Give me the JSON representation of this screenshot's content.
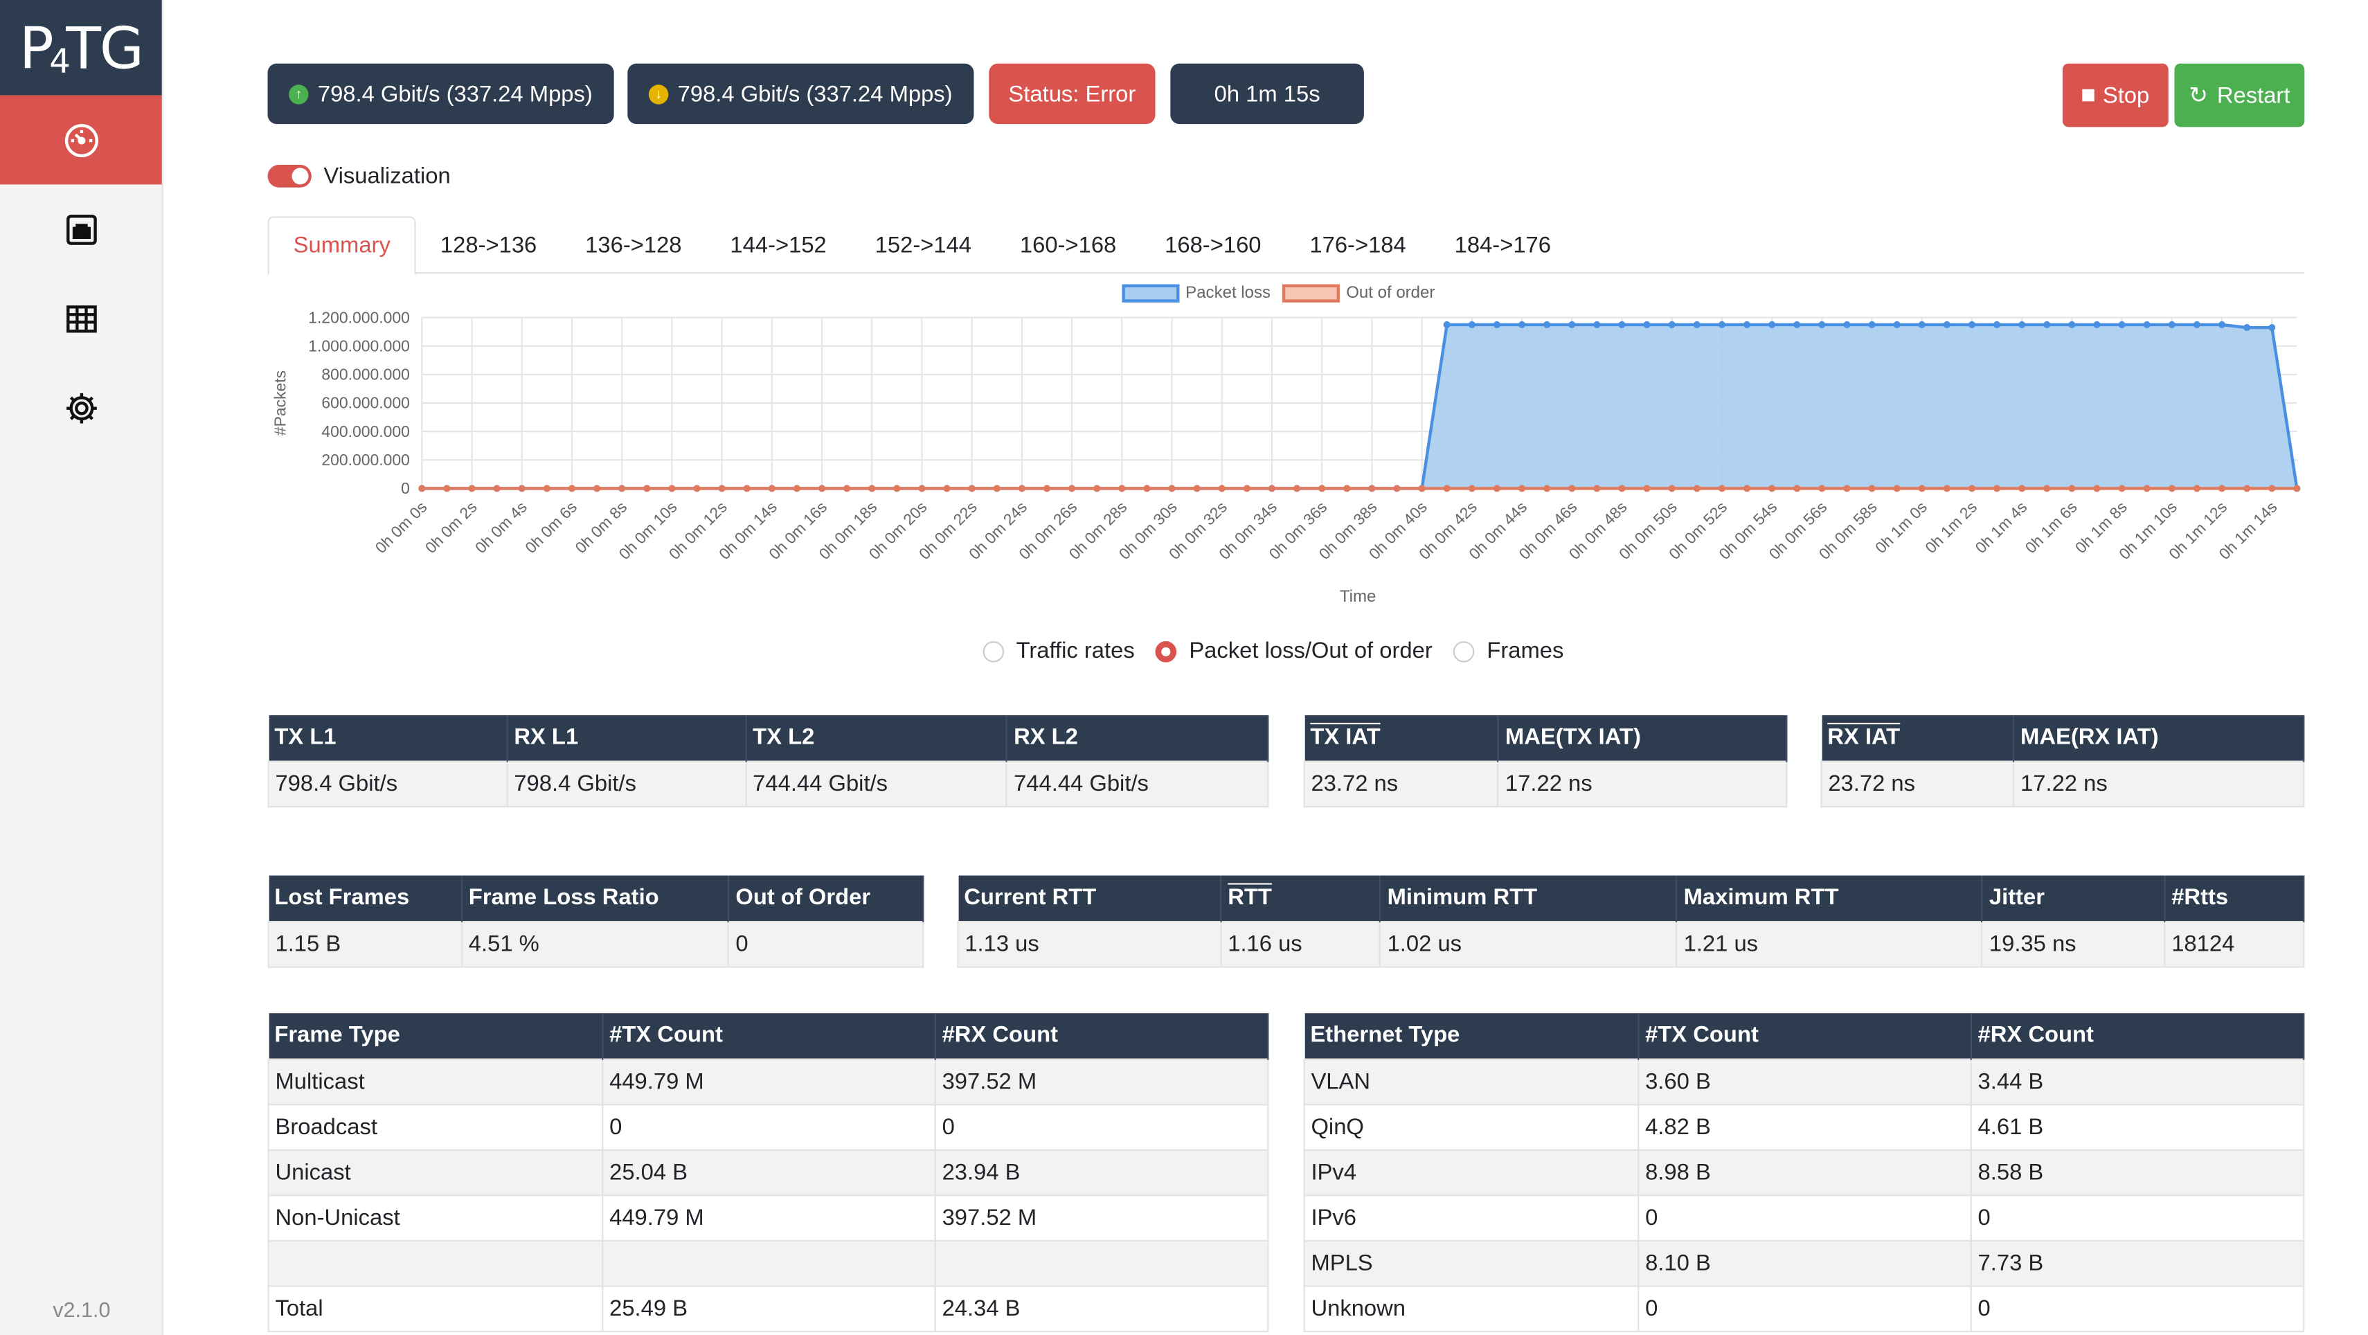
{
  "app": {
    "logo": "P4TG",
    "version": "v2.1.0"
  },
  "sidebar": {
    "items": [
      {
        "icon": "speedometer-icon",
        "active": true
      },
      {
        "icon": "ethernet-port-icon",
        "active": false
      },
      {
        "icon": "table-grid-icon",
        "active": false
      },
      {
        "icon": "gear-icon",
        "active": false
      }
    ]
  },
  "topbar": {
    "tx_rate": "798.4 Gbit/s (337.24 Mpps)",
    "rx_rate": "798.4 Gbit/s (337.24 Mpps)",
    "status": "Status: Error",
    "elapsed": "0h 1m 15s",
    "stop_label": "Stop",
    "restart_label": "Restart",
    "colors": {
      "dark": "#2e3c50",
      "red": "#d9534f",
      "green": "#4caf50"
    }
  },
  "visualization": {
    "label": "Visualization",
    "enabled": true
  },
  "tabs": [
    "Summary",
    "128->136",
    "136->128",
    "144->152",
    "152->144",
    "160->168",
    "168->160",
    "176->184",
    "184->176"
  ],
  "chart_data": {
    "type": "line",
    "xlabel": "Time",
    "ylabel": "#Packets",
    "ylim": [
      0,
      1200000000
    ],
    "y_ticks": [
      "0",
      "200.000.000",
      "400.000.000",
      "600.000.000",
      "800.000.000",
      "1.000.000.000",
      "1.200.000.000"
    ],
    "x_tick_labels": [
      "0h 0m 0s",
      "0h 0m 2s",
      "0h 0m 4s",
      "0h 0m 6s",
      "0h 0m 8s",
      "0h 0m 10s",
      "0h 0m 12s",
      "0h 0m 14s",
      "0h 0m 16s",
      "0h 0m 18s",
      "0h 0m 20s",
      "0h 0m 22s",
      "0h 0m 24s",
      "0h 0m 26s",
      "0h 0m 28s",
      "0h 0m 30s",
      "0h 0m 32s",
      "0h 0m 34s",
      "0h 0m 36s",
      "0h 0m 38s",
      "0h 0m 40s",
      "0h 0m 42s",
      "0h 0m 44s",
      "0h 0m 46s",
      "0h 0m 48s",
      "0h 0m 50s",
      "0h 0m 52s",
      "0h 0m 54s",
      "0h 0m 56s",
      "0h 0m 58s",
      "0h 1m 0s",
      "0h 1m 2s",
      "0h 1m 4s",
      "0h 1m 6s",
      "0h 1m 8s",
      "0h 1m 10s",
      "0h 1m 12s",
      "0h 1m 14s"
    ],
    "grid": true,
    "legend_position": "top",
    "series": [
      {
        "name": "Packet loss",
        "color": "#4a90e2",
        "fill": "#a9ccf0",
        "values": [
          0,
          0,
          0,
          0,
          0,
          0,
          0,
          0,
          0,
          0,
          0,
          0,
          0,
          0,
          0,
          0,
          0,
          0,
          0,
          0,
          0,
          0,
          0,
          0,
          0,
          0,
          0,
          0,
          0,
          0,
          0,
          0,
          0,
          0,
          0,
          0,
          0,
          0,
          0,
          0,
          0,
          1150000000,
          1150000000,
          1150000000,
          1150000000,
          1150000000,
          1150000000,
          1150000000,
          1150000000,
          1150000000,
          1150000000,
          1150000000,
          1150000000,
          1150000000,
          1150000000,
          1150000000,
          1150000000,
          1150000000,
          1150000000,
          1150000000,
          1150000000,
          1150000000,
          1150000000,
          1150000000,
          1150000000,
          1150000000,
          1150000000,
          1150000000,
          1150000000,
          1150000000,
          1150000000,
          1150000000,
          1150000000,
          1130000000,
          1130000000,
          0
        ]
      },
      {
        "name": "Out of order",
        "color": "#e07a5f",
        "fill": "#f6c6b3",
        "values": [
          0,
          0,
          0,
          0,
          0,
          0,
          0,
          0,
          0,
          0,
          0,
          0,
          0,
          0,
          0,
          0,
          0,
          0,
          0,
          0,
          0,
          0,
          0,
          0,
          0,
          0,
          0,
          0,
          0,
          0,
          0,
          0,
          0,
          0,
          0,
          0,
          0,
          0,
          0,
          0,
          0,
          0,
          0,
          0,
          0,
          0,
          0,
          0,
          0,
          0,
          0,
          0,
          0,
          0,
          0,
          0,
          0,
          0,
          0,
          0,
          0,
          0,
          0,
          0,
          0,
          0,
          0,
          0,
          0,
          0,
          0,
          0,
          0,
          0,
          0,
          0
        ]
      }
    ]
  },
  "radio": {
    "options": [
      "Traffic rates",
      "Packet loss/Out of order",
      "Frames"
    ],
    "selected": 1
  },
  "table_rates": {
    "headers": [
      "TX L1",
      "RX L1",
      "TX L2",
      "RX L2"
    ],
    "values": [
      "798.4 Gbit/s",
      "798.4 Gbit/s",
      "744.44 Gbit/s",
      "744.44 Gbit/s"
    ]
  },
  "table_tx_iat": {
    "headers": [
      "TX IAT",
      "MAE(TX IAT)"
    ],
    "values": [
      "23.72 ns",
      "17.22 ns"
    ]
  },
  "table_rx_iat": {
    "headers": [
      "RX IAT",
      "MAE(RX IAT)"
    ],
    "values": [
      "23.72 ns",
      "17.22 ns"
    ]
  },
  "table_loss": {
    "headers": [
      "Lost Frames",
      "Frame Loss Ratio",
      "Out of Order"
    ],
    "values": [
      "1.15 B",
      "4.51 %",
      "0"
    ]
  },
  "table_rtt": {
    "headers": [
      "Current RTT",
      "RTT",
      "Minimum RTT",
      "Maximum RTT",
      "Jitter",
      "#Rtts"
    ],
    "values": [
      "1.13 us",
      "1.16 us",
      "1.02 us",
      "1.21 us",
      "19.35 ns",
      "18124"
    ]
  },
  "table_frame_type": {
    "headers": [
      "Frame Type",
      "#TX Count",
      "#RX Count"
    ],
    "rows": [
      [
        "Multicast",
        "449.79 M",
        "397.52 M"
      ],
      [
        "Broadcast",
        "0",
        "0"
      ],
      [
        "Unicast",
        "25.04 B",
        "23.94 B"
      ],
      [
        "Non-Unicast",
        "449.79 M",
        "397.52 M"
      ],
      [
        "",
        "",
        ""
      ],
      [
        "Total",
        "25.49 B",
        "24.34 B"
      ]
    ]
  },
  "table_ethernet_type": {
    "headers": [
      "Ethernet Type",
      "#TX Count",
      "#RX Count"
    ],
    "rows": [
      [
        "VLAN",
        "3.60 B",
        "3.44 B"
      ],
      [
        "QinQ",
        "4.82 B",
        "4.61 B"
      ],
      [
        "IPv4",
        "8.98 B",
        "8.58 B"
      ],
      [
        "IPv6",
        "0",
        "0"
      ],
      [
        "MPLS",
        "8.10 B",
        "7.73 B"
      ],
      [
        "Unknown",
        "0",
        "0"
      ]
    ]
  }
}
